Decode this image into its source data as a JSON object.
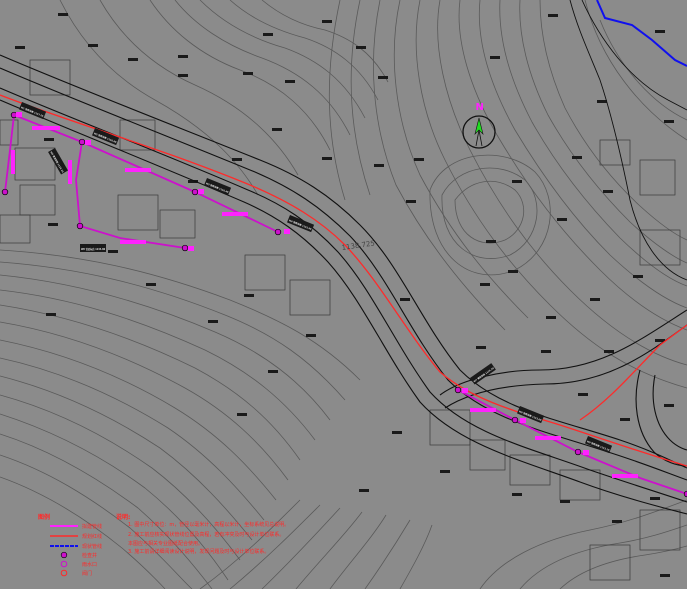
{
  "map": {
    "north_label": "N",
    "road_label": "1138.725",
    "colors": {
      "background": "#8b8b8b",
      "contour": "#5a5a5a",
      "road_edge": "#111111",
      "plan_line": "#ff2a2a",
      "pipeline": "#cc11cc",
      "existing_line": "#1010ee",
      "elevation_tag": "#1a1a1a",
      "label": "#ff2a2a"
    }
  },
  "legend": {
    "title": "图例",
    "items": [
      {
        "label": "拟建管线",
        "symbol": "pipeline"
      },
      {
        "label": "规划红线",
        "symbol": "plan-line"
      },
      {
        "label": "现状管线",
        "symbol": "existing-line"
      },
      {
        "label": "检查井",
        "symbol": "manhole"
      },
      {
        "label": "雨水口",
        "symbol": "inlet"
      },
      {
        "label": "阀门",
        "symbol": "valve"
      }
    ]
  },
  "notes": {
    "title": "说明:",
    "lines": [
      "1. 图中尺寸单位：m，管径以毫米计，高程以米计，坐标系统见总说明。",
      "2. 施工前应核实现状管线位置及高程，若有冲突及时与设计单位联系。",
      "   本图应与相关专业图纸配合使用。",
      "3. 施工前请详细阅读设计说明，发现问题及时与设计单位联系。"
    ]
  },
  "stations": [
    {
      "text": "W1 管底标高 1137.25"
    },
    {
      "text": "W2 管底标高 1136.80"
    },
    {
      "text": "W3 管底标高 1136.40"
    },
    {
      "text": "W4 管底标高 1135.90"
    },
    {
      "text": "W5 管底标高 1135.35"
    },
    {
      "text": "W6 管底标高 1134.80"
    },
    {
      "text": "W7 管底标高 1134.20"
    },
    {
      "text": "W8 管底标高 1133.60"
    },
    {
      "text": "W9 管底标高 1133.10"
    }
  ]
}
